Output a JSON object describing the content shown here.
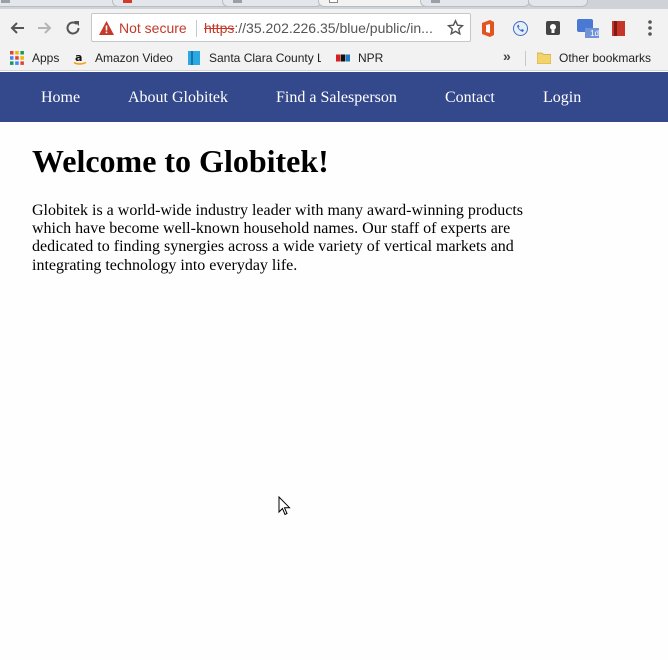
{
  "browser": {
    "security_label": "Not secure",
    "url_protocol": "https",
    "url_rest": "://35.202.226.35/blue/public/in...",
    "bookmarks": [
      {
        "label": "Apps",
        "icon": "apps-grid-icon"
      },
      {
        "label": "Amazon Video",
        "icon": "amazon-icon"
      },
      {
        "label": "Santa Clara County Li",
        "icon": "library-bookmark-icon"
      },
      {
        "label": "NPR",
        "icon": "npr-icon"
      }
    ],
    "bookmarks_overflow": "»",
    "other_bookmarks": "Other bookmarks",
    "extension_badge": "1d"
  },
  "site": {
    "nav": [
      {
        "label": "Home"
      },
      {
        "label": "About Globitek"
      },
      {
        "label": "Find a Salesperson"
      },
      {
        "label": "Contact"
      },
      {
        "label": "Login"
      }
    ],
    "nav_color": "#34488c",
    "heading": "Welcome to Globitek!",
    "intro": "Globitek is a world-wide industry leader with many award-winning products which have become well-known household names. Our staff of experts are dedicated to finding synergies across a wide variety of vertical markets and integrating technology into everyday life."
  }
}
